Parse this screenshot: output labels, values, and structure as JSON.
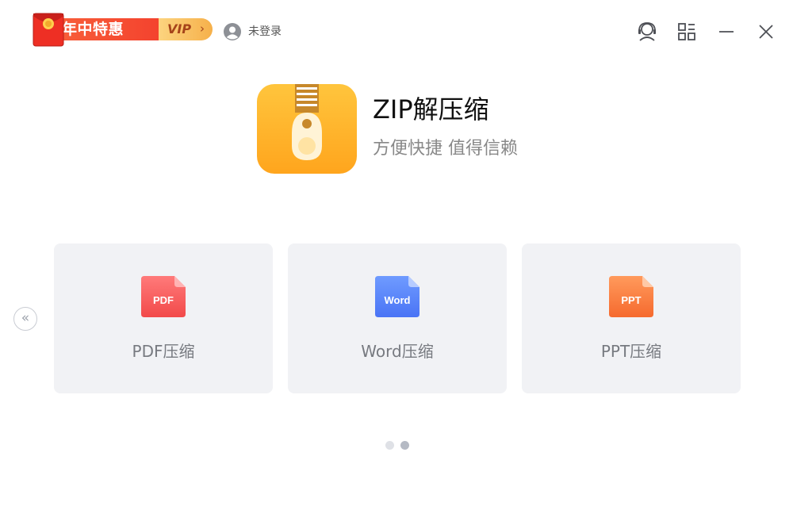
{
  "titlebar": {
    "promo_text": "年中特惠",
    "vip_label": "VIP",
    "vip_arrow": "›",
    "user_label": "未登录",
    "icons": {
      "redpacket": "red-envelope-icon",
      "user": "user-avatar-icon",
      "service": "customer-service-icon",
      "apps": "app-grid-icon",
      "minimize": "minimize-icon",
      "close": "close-icon"
    }
  },
  "header": {
    "title": "ZIP解压缩",
    "subtitle": "方便快捷 值得信赖",
    "logo_icon": "zip-archive-icon"
  },
  "carousel": {
    "prev_label": "«",
    "prev_icon": "double-chevron-left-icon",
    "cards": [
      {
        "badge": "PDF",
        "label": "PDF压缩",
        "color_top": "#ff7a7a",
        "color_bottom": "#f24a4a"
      },
      {
        "badge": "Word",
        "label": "Word压缩",
        "color_top": "#6f9bff",
        "color_bottom": "#4a74f5"
      },
      {
        "badge": "PPT",
        "label": "PPT压缩",
        "color_top": "#ff9a5c",
        "color_bottom": "#f66a2e"
      }
    ],
    "pages": [
      {
        "color": "#dfe1e6"
      },
      {
        "color": "#b5bac4"
      }
    ]
  },
  "colors": {
    "promo_red": "#f33b2b",
    "vip_gold": "#f6b04a",
    "logo_yellow": "#ffb52e",
    "card_bg": "#f1f2f5"
  }
}
